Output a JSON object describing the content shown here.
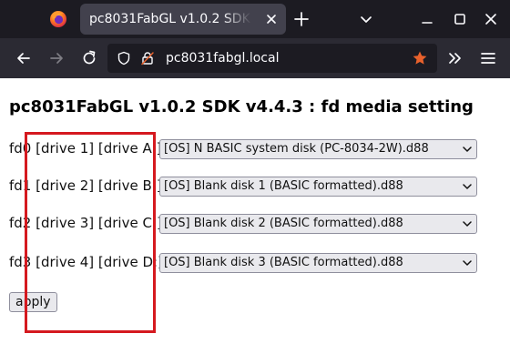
{
  "browser": {
    "tab_title": "pc8031FabGL v1.0.2 SDK v4.4.3 : fd media setting",
    "url": "pc8031fabgl.local",
    "icons": {
      "logo": "firefox-logo-icon",
      "tab_close": "close-icon",
      "new_tab": "plus-icon",
      "list_tabs": "chevron-down-icon",
      "minimize": "minimize-icon",
      "maximize": "maximize-icon",
      "close_window": "close-window-icon",
      "back": "back-arrow-icon",
      "forward": "forward-arrow-icon",
      "reload": "reload-icon",
      "shield": "shield-icon",
      "insecure": "insecure-lock-icon",
      "bookmark": "star-icon",
      "overflow": "double-chevron-icon",
      "menu": "hamburger-menu-icon"
    },
    "colors": {
      "tabbar": "#1c1b22",
      "toolbar": "#2b2a33",
      "active_tab": "#42414d",
      "bookmark_star": "#e8612c"
    }
  },
  "page": {
    "heading": "pc8031FabGL v1.0.2 SDK v4.4.3 : fd media setting",
    "drives": [
      {
        "label": "fd0 [drive 1] [drive A:]",
        "selected": "[OS] N BASIC system disk (PC-8034-2W).d88"
      },
      {
        "label": "fd1 [drive 2] [drive B:]",
        "selected": "[OS] Blank disk 1 (BASIC formatted).d88"
      },
      {
        "label": "fd2 [drive 3] [drive C:]",
        "selected": "[OS] Blank disk 2 (BASIC formatted).d88"
      },
      {
        "label": "fd3 [drive 4] [drive D:]",
        "selected": "[OS] Blank disk 3 (BASIC formatted).d88"
      }
    ],
    "apply_label": "apply",
    "highlight_color": "#d5191f"
  }
}
